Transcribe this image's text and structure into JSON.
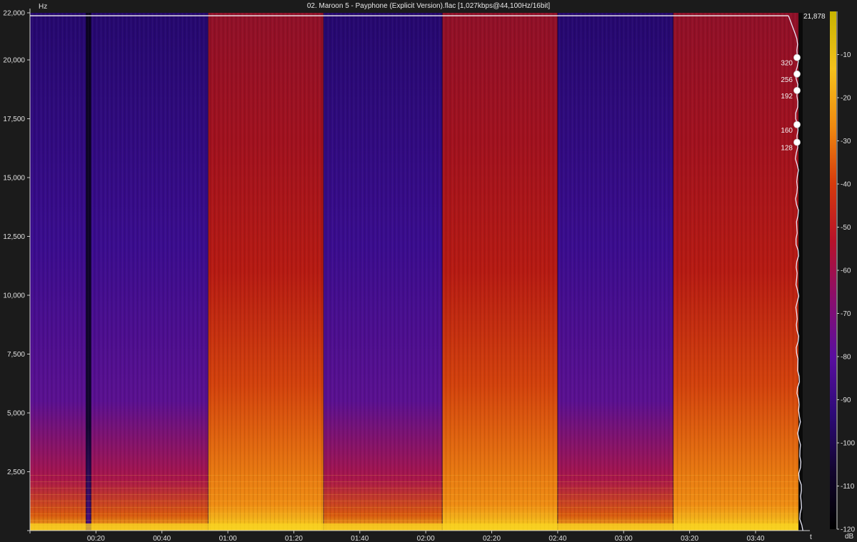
{
  "window": {
    "title": "02. Maroon 5 - Payphone (Explicit Version).flac [1,027kbps@44,100Hz/16bit]"
  },
  "chart_data": {
    "type": "heatmap",
    "title": "02. Maroon 5 - Payphone (Explicit Version).flac [1,027kbps@44,100Hz/16bit]",
    "xlabel": "t",
    "ylabel": "Hz",
    "colorbar_label": "dB",
    "xlim": [
      0,
      233
    ],
    "ylim": [
      0,
      22000
    ],
    "y_ticks": [
      {
        "v": 2500,
        "label": "2,500"
      },
      {
        "v": 5000,
        "label": "5,000"
      },
      {
        "v": 7500,
        "label": "7,500"
      },
      {
        "v": 10000,
        "label": "10,000"
      },
      {
        "v": 12500,
        "label": "12,500"
      },
      {
        "v": 15000,
        "label": "15,000"
      },
      {
        "v": 17500,
        "label": "17,500"
      },
      {
        "v": 20000,
        "label": "20,000"
      },
      {
        "v": 22000,
        "label": "22,000"
      }
    ],
    "x_ticks": [
      {
        "v": 20,
        "label": "00:20"
      },
      {
        "v": 40,
        "label": "00:40"
      },
      {
        "v": 60,
        "label": "01:00"
      },
      {
        "v": 80,
        "label": "01:20"
      },
      {
        "v": 100,
        "label": "01:40"
      },
      {
        "v": 120,
        "label": "02:00"
      },
      {
        "v": 140,
        "label": "02:20"
      },
      {
        "v": 160,
        "label": "02:40"
      },
      {
        "v": 180,
        "label": "03:00"
      },
      {
        "v": 200,
        "label": "03:20"
      },
      {
        "v": 220,
        "label": "03:40"
      }
    ],
    "colorbar": {
      "min": -120,
      "max": 0,
      "ticks": [
        -10,
        -20,
        -30,
        -40,
        -50,
        -60,
        -70,
        -80,
        -90,
        -100,
        -110,
        -120
      ],
      "colors": [
        "#000000",
        "#12052e",
        "#2d0a78",
        "#5a0ea0",
        "#8a0e6e",
        "#b8122a",
        "#d63a0c",
        "#ef8a10",
        "#f5c11c",
        "#c8b400"
      ]
    },
    "segments": [
      {
        "t0": 0,
        "t1": 17,
        "level": "quiet"
      },
      {
        "t0": 17,
        "t1": 18.5,
        "level": "silent"
      },
      {
        "t0": 18.5,
        "t1": 54,
        "level": "quiet"
      },
      {
        "t0": 54,
        "t1": 89,
        "level": "loud"
      },
      {
        "t0": 89,
        "t1": 125,
        "level": "quiet"
      },
      {
        "t0": 125,
        "t1": 160,
        "level": "loud"
      },
      {
        "t0": 160,
        "t1": 195,
        "level": "quiet"
      },
      {
        "t0": 195,
        "t1": 233,
        "level": "loud"
      }
    ],
    "cutoff": {
      "freq": 21878,
      "label": "21,878"
    },
    "bitrate_markers": [
      {
        "freq": 20100,
        "label": "320"
      },
      {
        "freq": 19400,
        "label": "256"
      },
      {
        "freq": 18700,
        "label": "192"
      },
      {
        "freq": 17250,
        "label": "160"
      },
      {
        "freq": 16500,
        "label": "128"
      }
    ]
  }
}
